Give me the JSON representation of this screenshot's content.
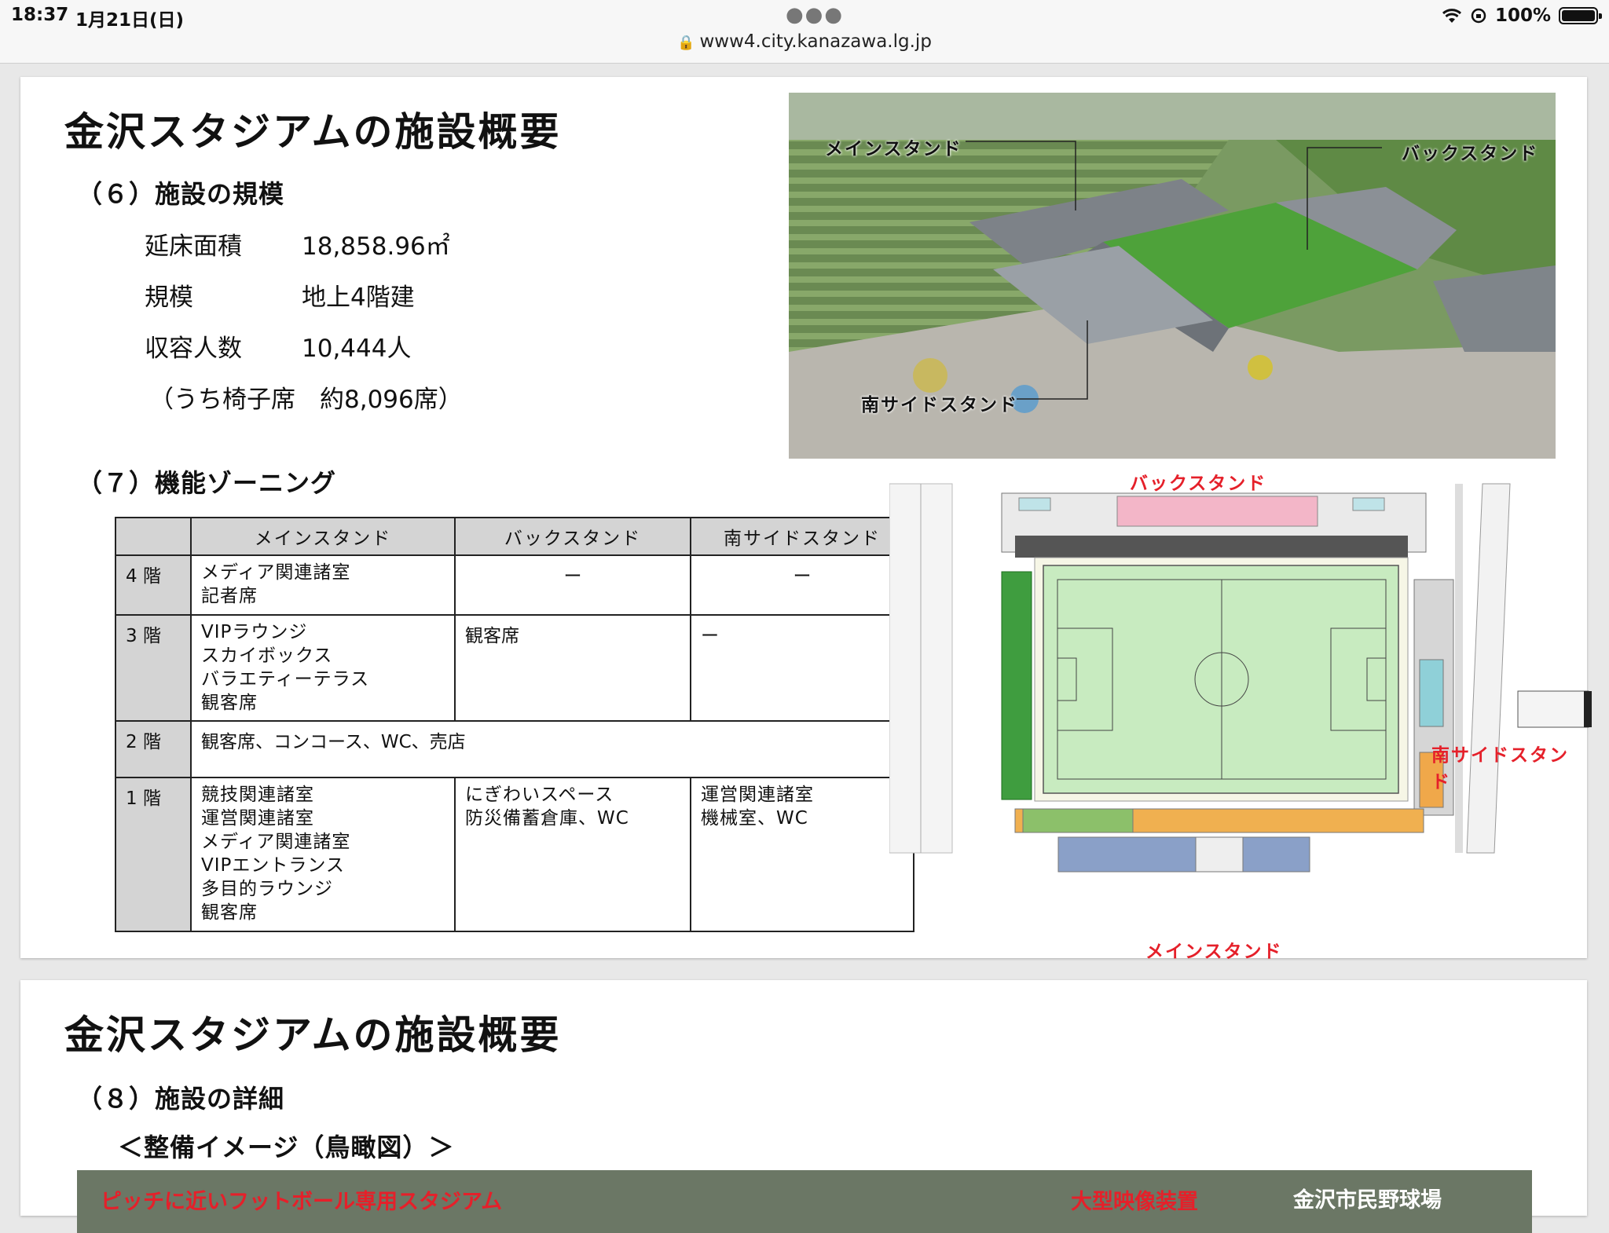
{
  "status_bar": {
    "time": "18:37",
    "date": "1月21日(日)",
    "url": "www4.city.kanazawa.lg.jp",
    "battery": "100%",
    "battery_level": 1.0
  },
  "slide1": {
    "title": "金沢スタジアムの施設概要",
    "section6": {
      "heading": "（６）施設の規模",
      "specs": [
        {
          "label": "延床面積",
          "value": "18,858.96㎡"
        },
        {
          "label": "規模",
          "value": "地上4階建"
        },
        {
          "label": "収容人数",
          "value": "10,444人"
        }
      ],
      "note": "（うち椅子席　約8,096席）"
    },
    "photo_labels": {
      "main": "メインスタンド",
      "back": "バックスタンド",
      "south": "南サイドスタンド"
    },
    "section7": {
      "heading": "（７）機能ゾーニング",
      "columns": [
        "",
        "メインスタンド",
        "バックスタンド",
        "南サイドスタンド"
      ],
      "rows": [
        {
          "floor": "4 階",
          "main": [
            "メディア関連諸室",
            "記者席"
          ],
          "back": [
            "ー"
          ],
          "south": [
            "ー"
          ]
        },
        {
          "floor": "3 階",
          "main": [
            "VIPラウンジ",
            "スカイボックス",
            "バラエティーテラス",
            "観客席"
          ],
          "back": [
            "観客席"
          ],
          "south": [
            "ー"
          ]
        },
        {
          "floor": "2 階",
          "merged": "観客席、コンコース、WC、売店"
        },
        {
          "floor": "1 階",
          "main": [
            "競技関連諸室",
            "運営関連諸室",
            "メディア関連諸室",
            "VIPエントランス",
            "多目的ラウンジ",
            "観客席"
          ],
          "back": [
            "にぎわいスペース",
            "防災備蓄倉庫、WC"
          ],
          "south": [
            "運営関連諸室",
            "機械室、WC"
          ]
        }
      ]
    },
    "plan_labels": {
      "back": "バックスタンド",
      "south": "南サイドスタンド",
      "main": "メインスタンド"
    }
  },
  "slide2": {
    "title": "金沢スタジアムの施設概要",
    "heading": "（８）施設の詳細",
    "subheading": "＜整備イメージ（鳥瞰図）＞",
    "image_labels": [
      "ピッチに近いフットボール専用スタジアム",
      "大型映像装置",
      "金沢市民野球場"
    ]
  }
}
